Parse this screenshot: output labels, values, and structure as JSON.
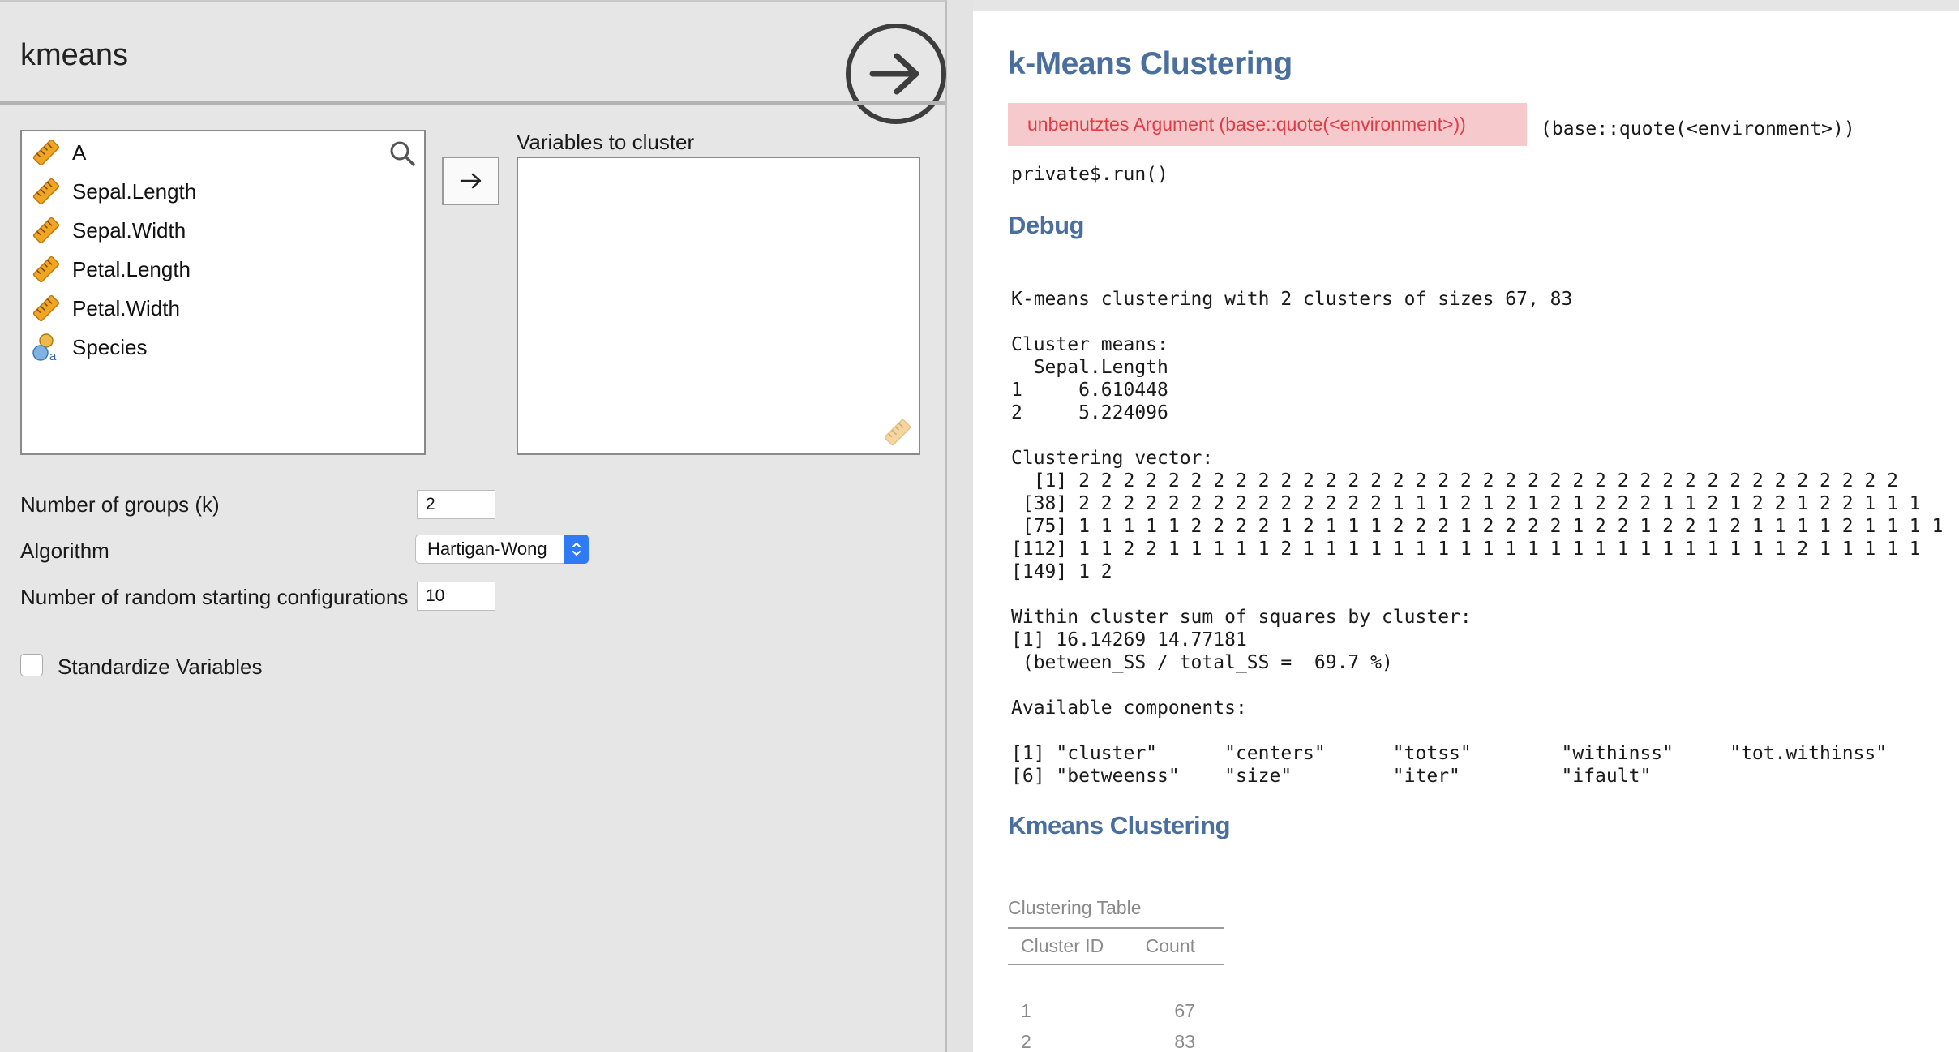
{
  "left_panel": {
    "title": "kmeans",
    "variables": [
      {
        "label": "A",
        "icon": "ruler-icon"
      },
      {
        "label": "Sepal.Length",
        "icon": "ruler-icon"
      },
      {
        "label": "Sepal.Width",
        "icon": "ruler-icon"
      },
      {
        "label": "Petal.Length",
        "icon": "ruler-icon"
      },
      {
        "label": "Petal.Width",
        "icon": "ruler-icon"
      },
      {
        "label": "Species",
        "icon": "nominal-icon"
      }
    ],
    "target_label": "Variables to cluster",
    "options": {
      "groups_label": "Number of groups (k)",
      "groups_value": "2",
      "algorithm_label": "Algorithm",
      "algorithm_value": "Hartigan-Wong",
      "random_label": "Number of random starting configurations",
      "random_value": "10",
      "standardize_label": "Standardize Variables",
      "standardize_checked": false
    }
  },
  "results": {
    "title": "k-Means Clustering",
    "error_message": "unbenutztes Argument (base::quote(<environment>))",
    "error_code": "(base::quote(<environment>))",
    "run_call": "private$.run()",
    "debug_heading": "Debug",
    "debug_output": "K-means clustering with 2 clusters of sizes 67, 83\n\nCluster means:\n  Sepal.Length\n1     6.610448\n2     5.224096\n\nClustering vector:\n  [1] 2 2 2 2 2 2 2 2 2 2 2 2 2 2 2 2 2 2 2 2 2 2 2 2 2 2 2 2 2 2 2 2 2 2 2 2 2\n [38] 2 2 2 2 2 2 2 2 2 2 2 2 2 2 1 1 1 2 1 2 1 2 1 2 2 2 1 1 2 1 2 2 1 2 2 1 1 1\n [75] 1 1 1 1 1 2 2 2 2 1 2 1 1 1 2 2 2 1 2 2 2 2 1 2 2 1 2 2 1 2 1 1 1 1 2 1 1 1 1\n[112] 1 1 2 2 1 1 1 1 1 2 1 1 1 1 1 1 1 1 1 1 1 1 1 1 1 1 1 1 1 1 1 1 2 1 1 1 1 1\n[149] 1 2\n\nWithin cluster sum of squares by cluster:\n[1] 16.14269 14.77181\n (between_SS / total_SS =  69.7 %)\n\nAvailable components:\n\n[1] \"cluster\"      \"centers\"      \"totss\"        \"withinss\"     \"tot.withinss\"\n[6] \"betweenss\"    \"size\"         \"iter\"         \"ifault\"",
    "kmeans_heading": "Kmeans Clustering",
    "table": {
      "caption": "Clustering Table",
      "headers": [
        "Cluster ID",
        "Count"
      ],
      "rows": [
        [
          "1",
          "67"
        ],
        [
          "2",
          "83"
        ]
      ]
    }
  },
  "colors": {
    "heading": "#4a6f9f",
    "error_bg": "#f6c9cc",
    "error_text": "#e23b45",
    "select_accent": "#2f7bf5",
    "ruler_icon": "#f0a623",
    "nominal_icon": "#5c9bd6"
  }
}
